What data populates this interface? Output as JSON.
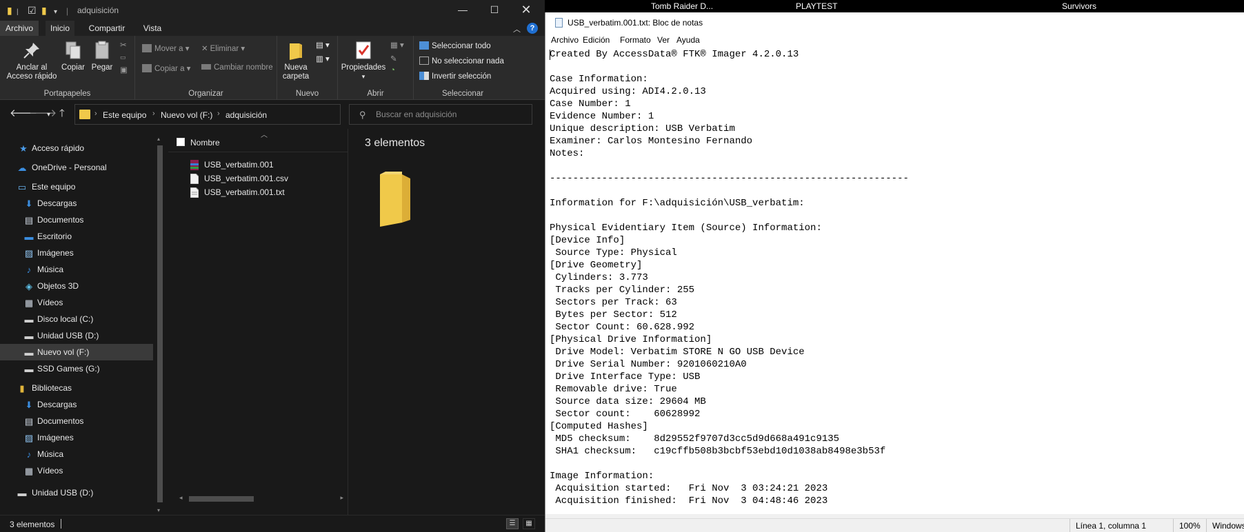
{
  "explorer": {
    "window_title": "adquisición",
    "tabs": {
      "archivo": "Archivo",
      "inicio": "Inicio",
      "compartir": "Compartir",
      "vista": "Vista"
    },
    "help": "?",
    "ribbon": {
      "pin_quick_access": "Anclar al Acceso rápido",
      "copy": "Copiar",
      "paste": "Pegar",
      "group_clipboard": "Portapapeles",
      "move_to": "Mover a",
      "copy_to": "Copiar a",
      "delete": "Eliminar",
      "rename": "Cambiar nombre",
      "group_organize": "Organizar",
      "new_folder": "Nueva carpeta",
      "group_new": "Nuevo",
      "properties": "Propiedades",
      "group_open": "Abrir",
      "select_all": "Seleccionar todo",
      "select_none": "No seleccionar nada",
      "invert_selection": "Invertir selección",
      "group_select": "Seleccionar"
    },
    "breadcrumb": [
      "Este equipo",
      "Nuevo vol (F:)",
      "adquisición"
    ],
    "search_placeholder": "Buscar en adquisición",
    "nav_items": [
      {
        "label": "Acceso rápido",
        "icon": "star-icon"
      },
      {
        "label": "OneDrive - Personal",
        "icon": "cloud-icon"
      },
      {
        "label": "Este equipo",
        "icon": "computer-icon"
      },
      {
        "label": "Descargas",
        "icon": "download-icon"
      },
      {
        "label": "Documentos",
        "icon": "document-icon"
      },
      {
        "label": "Escritorio",
        "icon": "desktop-folder-icon"
      },
      {
        "label": "Imágenes",
        "icon": "pictures-icon"
      },
      {
        "label": "Música",
        "icon": "music-icon"
      },
      {
        "label": "Objetos 3D",
        "icon": "cube-icon"
      },
      {
        "label": "Vídeos",
        "icon": "video-icon"
      },
      {
        "label": "Disco local (C:)",
        "icon": "drive-icon"
      },
      {
        "label": "Unidad USB (D:)",
        "icon": "usb-drive-icon"
      },
      {
        "label": "Nuevo vol (F:)",
        "icon": "drive-icon",
        "selected": true
      },
      {
        "label": "SSD Games (G:)",
        "icon": "drive-icon"
      },
      {
        "label": "Bibliotecas",
        "icon": "library-icon"
      },
      {
        "label": "Descargas",
        "icon": "download-icon"
      },
      {
        "label": "Documentos",
        "icon": "document-icon"
      },
      {
        "label": "Imágenes",
        "icon": "pictures-icon"
      },
      {
        "label": "Música",
        "icon": "music-icon"
      },
      {
        "label": "Vídeos",
        "icon": "video-icon"
      },
      {
        "label": "Unidad USB (D:)",
        "icon": "usb-drive-icon"
      }
    ],
    "column_name": "Nombre",
    "files": [
      {
        "name": "USB_verbatim.001",
        "icon": "archive-file-icon"
      },
      {
        "name": "USB_verbatim.001.csv",
        "icon": "text-file-icon"
      },
      {
        "name": "USB_verbatim.001.txt",
        "icon": "text-file-icon"
      }
    ],
    "preview_count": "3 elementos",
    "status_count": "3 elementos",
    "colors": {
      "folder": "#f0c94a",
      "selection": "#3a3a3a",
      "background": "#191919"
    }
  },
  "taskbar": {
    "items": [
      "Tomb Raider D...",
      "PLAYTEST",
      "Survivors"
    ]
  },
  "notepad": {
    "title": "USB_verbatim.001.txt: Bloc de notas",
    "menu": [
      "Archivo",
      "Edición",
      "Formato",
      "Ver",
      "Ayuda"
    ],
    "lines": [
      "Created By AccessData® FTK® Imager 4.2.0.13",
      "",
      "Case Information:",
      "Acquired using: ADI4.2.0.13",
      "Case Number: 1",
      "Evidence Number: 1",
      "Unique description: USB Verbatim",
      "Examiner: Carlos Montesino Fernando",
      "Notes:",
      "",
      "--------------------------------------------------------------",
      "",
      "Information for F:\\adquisición\\USB_verbatim:",
      "",
      "Physical Evidentiary Item (Source) Information:",
      "[Device Info]",
      " Source Type: Physical",
      "[Drive Geometry]",
      " Cylinders: 3.773",
      " Tracks per Cylinder: 255",
      " Sectors per Track: 63",
      " Bytes per Sector: 512",
      " Sector Count: 60.628.992",
      "[Physical Drive Information]",
      " Drive Model: Verbatim STORE N GO USB Device",
      " Drive Serial Number: 9201060210A0",
      " Drive Interface Type: USB",
      " Removable drive: True",
      " Source data size: 29604 MB",
      " Sector count:    60628992",
      "[Computed Hashes]",
      " MD5 checksum:    8d29552f9707d3cc5d9d668a491c9135",
      " SHA1 checksum:   c19cffb508b3bcbf53ebd10d1038ab8498e3b53f",
      "",
      "Image Information:",
      " Acquisition started:   Fri Nov  3 03:24:21 2023",
      " Acquisition finished:  Fri Nov  3 04:48:46 2023"
    ],
    "status": {
      "position": "Línea 1, columna 1",
      "zoom": "100%",
      "line_endings": "Windows"
    }
  }
}
